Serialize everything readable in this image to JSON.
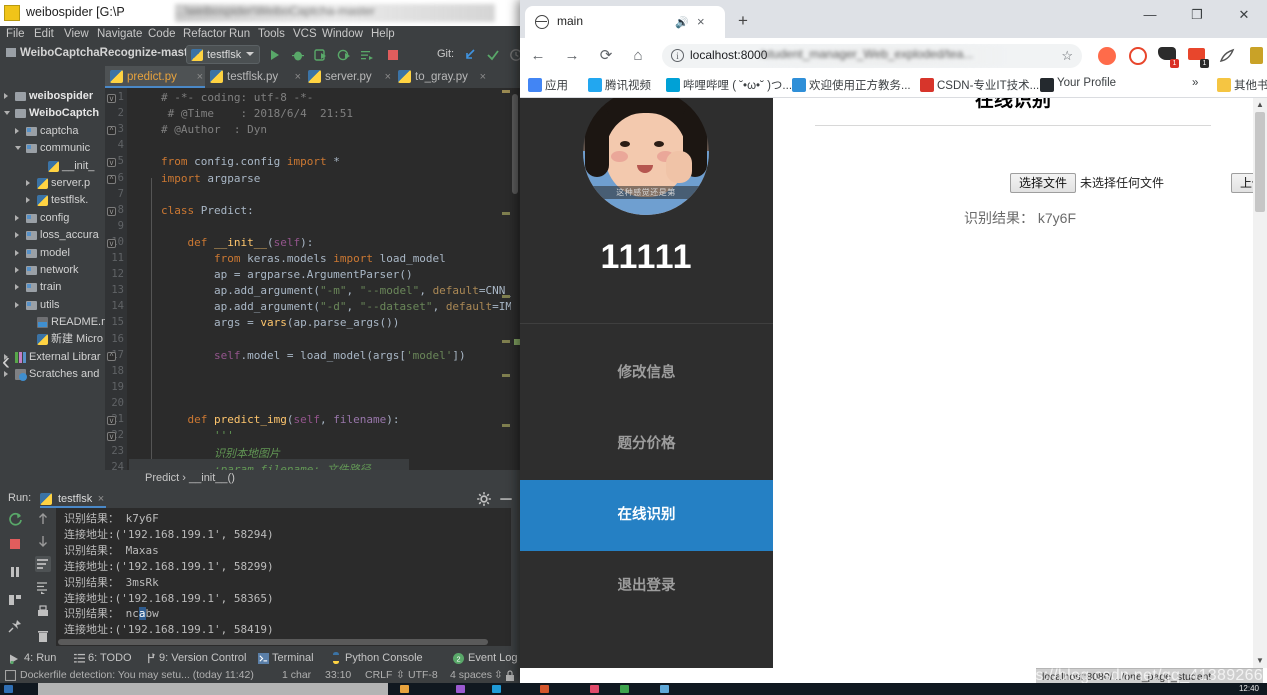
{
  "ide": {
    "title": "weibospider [G:\\P",
    "title_blurred": "...\\weibospider\\WeiboCaptcha-master",
    "menus": [
      "File",
      "Edit",
      "View",
      "Navigate",
      "Code",
      "Refactor",
      "Run",
      "Tools",
      "VCS",
      "Window",
      "Help"
    ],
    "breadcrumb": "WeiboCaptchaRecognize-mast",
    "run_config": "testflsk",
    "git_label": "Git:",
    "editor_tabs": [
      {
        "label": "predict.py",
        "active": true
      },
      {
        "label": "testflsk.py",
        "active": false
      },
      {
        "label": "server.py",
        "active": false
      },
      {
        "label": "to_gray.py",
        "active": false
      }
    ],
    "project_tree": [
      {
        "label": "weibospider",
        "depth": 1,
        "arrow": "closed",
        "icon": "folder",
        "bold": true
      },
      {
        "label": "WeiboCaptch",
        "depth": 1,
        "arrow": "open",
        "icon": "folder",
        "bold": true
      },
      {
        "label": "captcha",
        "depth": 2,
        "arrow": "closed",
        "icon": "folder-src",
        "bold": false
      },
      {
        "label": "communic",
        "depth": 2,
        "arrow": "open",
        "icon": "folder-src",
        "bold": false
      },
      {
        "label": "__init_",
        "depth": 4,
        "arrow": "none",
        "icon": "py",
        "bold": false
      },
      {
        "label": "server.p",
        "depth": 3,
        "arrow": "closed",
        "icon": "py",
        "bold": false
      },
      {
        "label": "testflsk.",
        "depth": 3,
        "arrow": "closed",
        "icon": "py",
        "bold": false
      },
      {
        "label": "config",
        "depth": 2,
        "arrow": "closed",
        "icon": "folder-src",
        "bold": false
      },
      {
        "label": "loss_accura",
        "depth": 2,
        "arrow": "closed",
        "icon": "folder-src",
        "bold": false
      },
      {
        "label": "model",
        "depth": 2,
        "arrow": "closed",
        "icon": "folder-src",
        "bold": false
      },
      {
        "label": "network",
        "depth": 2,
        "arrow": "closed",
        "icon": "folder-src",
        "bold": false
      },
      {
        "label": "train",
        "depth": 2,
        "arrow": "closed",
        "icon": "folder-src",
        "bold": false
      },
      {
        "label": "utils",
        "depth": 2,
        "arrow": "closed",
        "icon": "folder-src",
        "bold": false
      },
      {
        "label": "README.m",
        "depth": 3,
        "arrow": "none",
        "icon": "md",
        "bold": false
      },
      {
        "label": "新建 Micro",
        "depth": 3,
        "arrow": "none",
        "icon": "py",
        "bold": false
      },
      {
        "label": "External Librar",
        "depth": 1,
        "arrow": "closed",
        "icon": "ext",
        "bold": false
      },
      {
        "label": "Scratches and",
        "depth": 1,
        "arrow": "closed",
        "icon": "scratch",
        "bold": false
      }
    ],
    "code_lines": [
      {
        "n": 1,
        "html": "<span class='c-cmt'># -*- coding: utf-8 -*-</span>"
      },
      {
        "n": 2,
        "html": "<span class='c-cmt'> # @Time    : 2018/6/4  21:51</span>"
      },
      {
        "n": 3,
        "html": "<span class='c-cmt'># @Author  : Dyn</span>"
      },
      {
        "n": 4,
        "html": ""
      },
      {
        "n": 5,
        "html": "<span class='c-kw'>from</span> config.config <span class='c-kw'>import</span> *"
      },
      {
        "n": 6,
        "html": "<span class='c-kw'>import</span> argparse"
      },
      {
        "n": 7,
        "html": ""
      },
      {
        "n": 8,
        "html": "<span class='c-kw'>class</span> <span class='c-cls'>Predict</span>:"
      },
      {
        "n": 9,
        "html": ""
      },
      {
        "n": 10,
        "html": "    <span class='c-kw'>def</span> <span class='c-fn'>__init__</span>(<span class='c-self'>self</span>):"
      },
      {
        "n": 11,
        "html": "        <span class='c-kw'>from</span> keras.models <span class='c-kw'>import</span> load_model"
      },
      {
        "n": 12,
        "html": "        ap = argparse.ArgumentParser()"
      },
      {
        "n": 13,
        "html": "        ap.add_argument(<span class='c-str'>\"-m\"</span>, <span class='c-str'>\"--model\"</span>, <span class='c-kwarg'>default</span>=CNN_MODEL, <span class='c-kwarg'>help</span>=<span class='c-str'>\"</span>"
      },
      {
        "n": 14,
        "html": "        ap.add_argument(<span class='c-str'>\"-d\"</span>, <span class='c-str'>\"--dataset\"</span>, <span class='c-kwarg'>default</span>=IMAGES_PATH, <span class='c-kwarg'>he</span>"
      },
      {
        "n": 15,
        "html": "        args = <span class='c-fn'>vars</span>(ap.parse_args())"
      },
      {
        "n": 16,
        "html": ""
      },
      {
        "n": 17,
        "html": "        <span class='c-self'>self</span>.model = load_model(args[<span class='c-str'>'model'</span>])"
      },
      {
        "n": 18,
        "html": ""
      },
      {
        "n": 19,
        "html": ""
      },
      {
        "n": 20,
        "html": ""
      },
      {
        "n": 21,
        "html": "    <span class='c-kw'>def</span> <span class='c-fn'>predict_img</span>(<span class='c-self'>self</span>, <span class='c-param'>filename</span>):"
      },
      {
        "n": 22,
        "html": "        <span class='c-doc'>'''</span>"
      },
      {
        "n": 23,
        "html": "        <span class='c-doc'>识别本地图片</span>"
      },
      {
        "n": 24,
        "html": "        <span class='c-doc'>:param filename: 文件路径</span>"
      }
    ],
    "breadcrumb_bottom": "Predict  ›  __init__()",
    "run_panel": {
      "label": "Run:",
      "tab": "testflsk",
      "console_lines": [
        "识别结果： k7y6F",
        "连接地址:('192.168.199.1', 58294)",
        "识别结果： Maxas",
        "连接地址:('192.168.199.1', 58299)",
        "识别结果： 3msRk",
        "连接地址:('192.168.199.1', 58365)",
        "识别结果： ncabw",
        "连接地址:('192.168.199.1', 58419)",
        "识别结果： k7y6F"
      ]
    },
    "bottom_tools": [
      "4: Run",
      "6: TODO",
      "9: Version Control",
      "Terminal",
      "Python Console",
      "Event Log"
    ],
    "status_items": [
      "Dockerfile detection: You may setu... (today 11:42)",
      "1 char",
      "33:10",
      "CRLF",
      "UTF-8",
      "4 spaces"
    ]
  },
  "chrome": {
    "tab_title": "main",
    "url_visible": "localhost:8000",
    "url_blurred": "/student_manager_Web_exploded/tea...",
    "bookmarks": [
      {
        "label": "应用",
        "color": "#4285f4"
      },
      {
        "label": "腾讯视频",
        "color": "#22a7f0"
      },
      {
        "label": "哔哩哔哩 ( ˘•ω•˘ )つ...",
        "color": "#00a1d6"
      },
      {
        "label": "欢迎使用正方教务...",
        "color": "#2f8fd8"
      },
      {
        "label": "CSDN-专业IT技术...",
        "color": "#d7352b"
      },
      {
        "label": "Your Profile",
        "color": "#24292e"
      },
      {
        "label": "其他书签",
        "color": "#f5c542"
      }
    ],
    "bookmarks_overflow": "»",
    "status_tip": "localhost:8080/.../one_page_student"
  },
  "page": {
    "user_name": "11111",
    "avatar_caption": "这种感觉还是第",
    "menu": [
      {
        "label": "修改信息",
        "active": false
      },
      {
        "label": "题分价格",
        "active": false
      },
      {
        "label": "在线识别",
        "active": true
      },
      {
        "label": "退出登录",
        "active": false
      }
    ],
    "title": "在线识别",
    "choose_file_label": "选择文件",
    "no_file_label": "未选择任何文件",
    "upload_label": "上传",
    "result_text": "识别结果： k7y6F"
  },
  "watermark": "https://blog.csdn.net/qq_41389266",
  "taskbar": {
    "clock": "12:40"
  },
  "colors": {
    "ide_bg": "#3c3f41",
    "editor_bg": "#2b2b2b",
    "accent_blue": "#2580c4",
    "sidebar_dark": "#2e2e2e",
    "tab_active": "#e8a33d"
  }
}
